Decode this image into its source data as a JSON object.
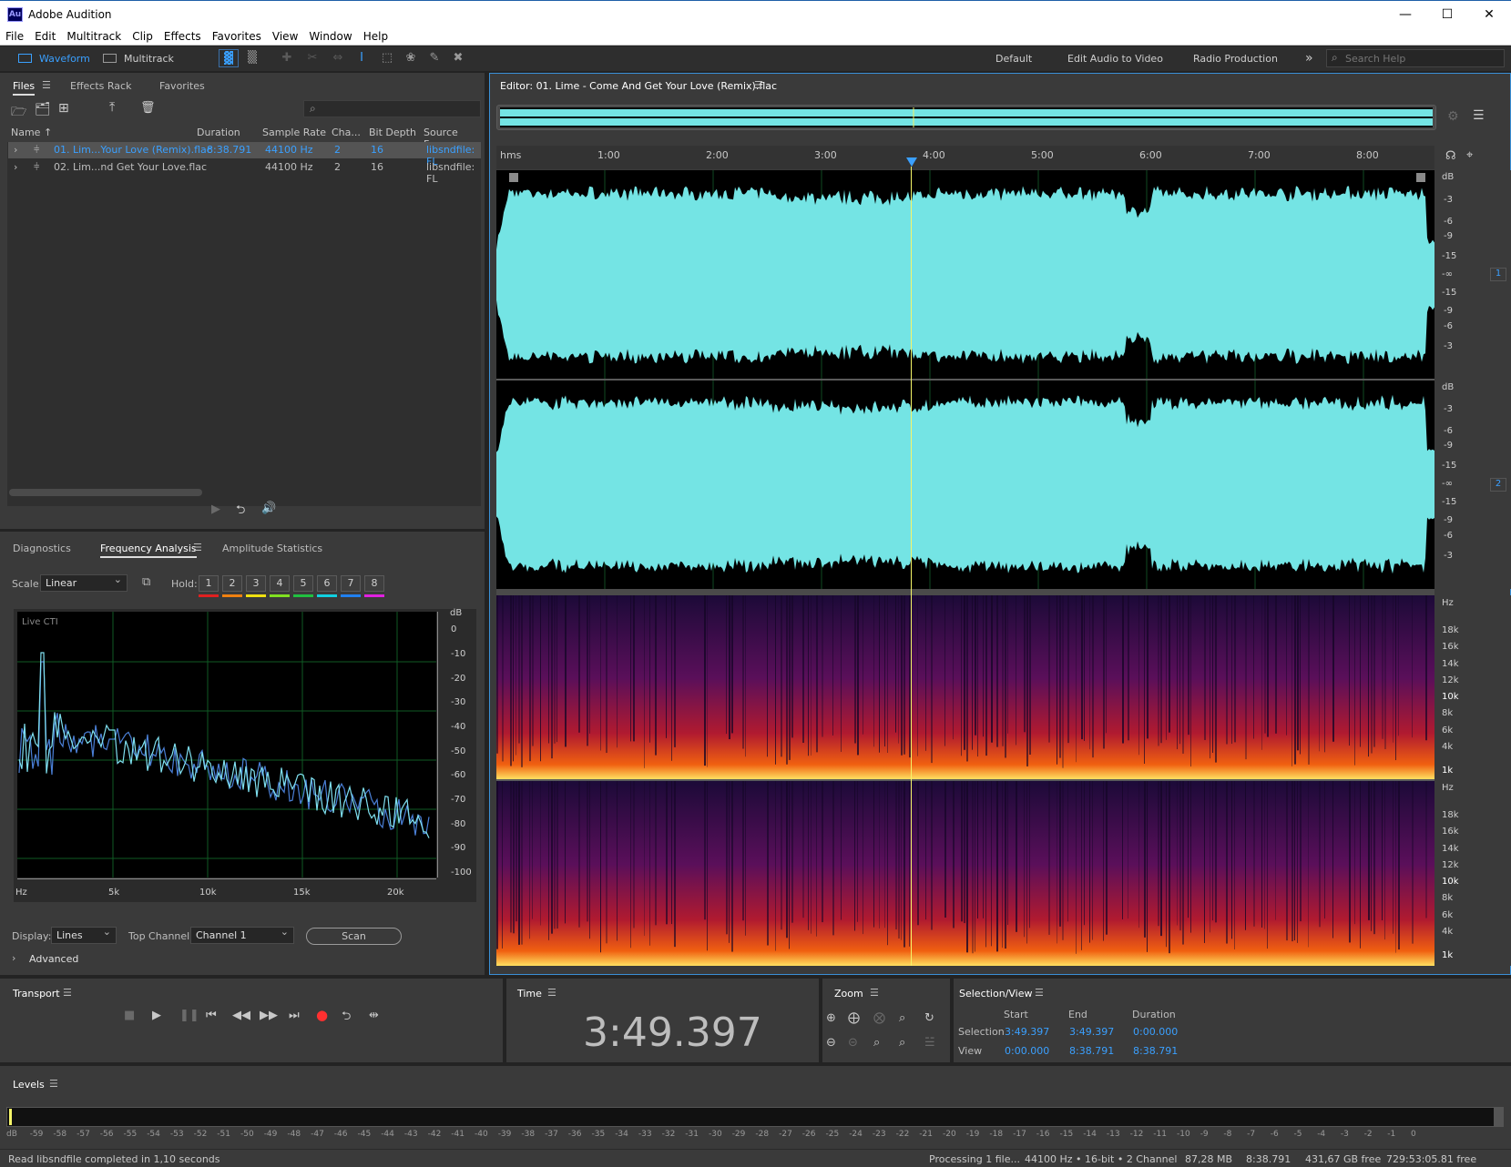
{
  "app": {
    "title": "Adobe Audition",
    "logo": "Au"
  },
  "window_controls": {
    "minimize": "—",
    "maximize": "☐",
    "close": "✕"
  },
  "menu": [
    "File",
    "Edit",
    "Multitrack",
    "Clip",
    "Effects",
    "Favorites",
    "View",
    "Window",
    "Help"
  ],
  "toolbar": {
    "waveform_label": "Waveform",
    "multitrack_label": "Multitrack",
    "workspaces": [
      "Default",
      "Edit Audio to Video",
      "Radio Production"
    ],
    "more": "»",
    "search_placeholder": "Search Help"
  },
  "files_panel": {
    "tabs": [
      "Files",
      "Effects Rack",
      "Favorites"
    ],
    "columns": [
      "Name ↑",
      "Duration",
      "Sample Rate",
      "Cha...",
      "Bit Depth",
      "Source Forma"
    ],
    "rows": [
      {
        "name": "01. Lim...Your Love (Remix).flac",
        "duration": "8:38.791",
        "sample_rate": "44100 Hz",
        "channels": "2",
        "bit_depth": "16",
        "source": "libsndfile: FL",
        "selected": true
      },
      {
        "name": "02. Lim...nd Get Your Love.flac",
        "duration": "",
        "sample_rate": "44100 Hz",
        "channels": "2",
        "bit_depth": "16",
        "source": "libsndfile: FL",
        "selected": false
      }
    ]
  },
  "analysis_panel": {
    "tabs": [
      "Diagnostics",
      "Frequency Analysis",
      "Amplitude Statistics"
    ],
    "scale_label": "Scale:",
    "scale_value": "Linear",
    "hold_label": "Hold:",
    "hold_buttons": [
      "1",
      "2",
      "3",
      "4",
      "5",
      "6",
      "7",
      "8"
    ],
    "hold_colors": [
      "#e02020",
      "#f08010",
      "#f0e010",
      "#80e020",
      "#20c040",
      "#10d0e0",
      "#2080f0",
      "#e020e0"
    ],
    "graph_label": "Live CTI",
    "db_unit": "dB",
    "db_ticks": [
      "0",
      "-10",
      "-20",
      "-30",
      "-40",
      "-50",
      "-60",
      "-70",
      "-80",
      "-90",
      "-100"
    ],
    "hz_ticks": [
      "Hz",
      "5k",
      "10k",
      "15k",
      "20k"
    ],
    "display_label": "Display:",
    "display_value": "Lines",
    "top_channel_label": "Top Channel:",
    "top_channel_value": "Channel 1",
    "scan_label": "Scan",
    "advanced_label": "Advanced"
  },
  "editor": {
    "title": "Editor: 01. Lime - Come And Get Your Love (Remix).flac",
    "ruler_unit": "hms",
    "ruler_ticks": [
      "1:00",
      "2:00",
      "3:00",
      "4:00",
      "5:00",
      "6:00",
      "7:00",
      "8:00"
    ],
    "db_scale": [
      "dB",
      "-3",
      "-6",
      "-9",
      "-15",
      "-∞",
      "-15",
      "-9",
      "-6",
      "-3"
    ],
    "channel_numbers": [
      "1",
      "2"
    ],
    "hz_scale": [
      "Hz",
      "18k",
      "16k",
      "14k",
      "12k",
      "10k",
      "8k",
      "6k",
      "4k",
      "1k"
    ],
    "waveform_color": "#74e4e4",
    "playhead_color": "#f5f569"
  },
  "transport": {
    "title": "Transport"
  },
  "time_panel": {
    "title": "Time",
    "value": "3:49.397"
  },
  "zoom_panel": {
    "title": "Zoom"
  },
  "selection_panel": {
    "title": "Selection/View",
    "headers": [
      "Start",
      "End",
      "Duration"
    ],
    "selection_label": "Selection",
    "selection": [
      "3:49.397",
      "3:49.397",
      "0:00.000"
    ],
    "view_label": "View",
    "view": [
      "0:00.000",
      "8:38.791",
      "8:38.791"
    ]
  },
  "levels": {
    "title": "Levels",
    "scale": [
      "dB",
      "-59",
      "-58",
      "-57",
      "-56",
      "-55",
      "-54",
      "-53",
      "-52",
      "-51",
      "-50",
      "-49",
      "-48",
      "-47",
      "-46",
      "-45",
      "-44",
      "-43",
      "-42",
      "-41",
      "-40",
      "-39",
      "-38",
      "-37",
      "-36",
      "-35",
      "-34",
      "-33",
      "-32",
      "-31",
      "-30",
      "-29",
      "-28",
      "-27",
      "-26",
      "-25",
      "-24",
      "-23",
      "-22",
      "-21",
      "-20",
      "-19",
      "-18",
      "-17",
      "-16",
      "-15",
      "-14",
      "-13",
      "-12",
      "-11",
      "-10",
      "-9",
      "-8",
      "-7",
      "-6",
      "-5",
      "-4",
      "-3",
      "-2",
      "-1",
      "0"
    ]
  },
  "status": {
    "message": "Read libsndfile completed in 1,10 seconds",
    "processing": "Processing 1 file...",
    "format": "44100 Hz • 16-bit • 2 Channel",
    "size": "87,28 MB",
    "duration": "8:38.791",
    "free": "431,67 GB free",
    "time_free": "729:53:05.81 free"
  }
}
